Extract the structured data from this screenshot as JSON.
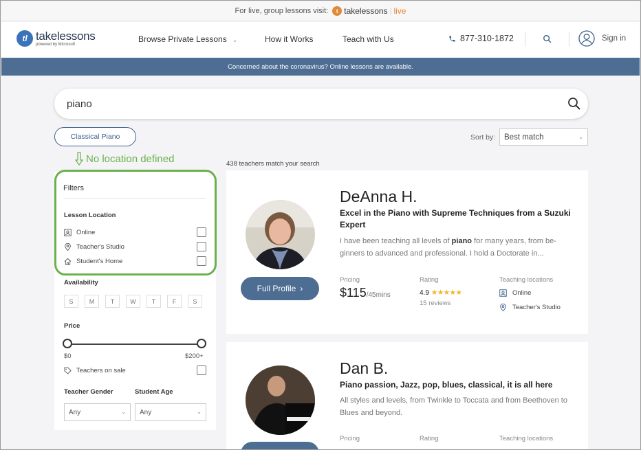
{
  "promo": {
    "text": "For live, group lessons visit:",
    "brand": "takelessons",
    "sep": "|",
    "live": "live"
  },
  "header": {
    "logo_name": "takelessons",
    "logo_sub": "powered by Microsoft",
    "nav": [
      "Browse Private Lessons",
      "How it Works",
      "Teach with Us"
    ],
    "phone": "877-310-1872",
    "sign_in": "Sign in"
  },
  "banner": "Concerned about the coronavirus? Online lessons are available.",
  "search": {
    "value": "piano"
  },
  "tag": "Classical Piano",
  "sort": {
    "label": "Sort by:",
    "value": "Best match"
  },
  "annotation": "No location defined",
  "results_count": "438 teachers match your search",
  "filters": {
    "title": "Filters",
    "lesson_location": {
      "heading": "Lesson Location",
      "options": [
        "Online",
        "Teacher's Studio",
        "Student's Home"
      ]
    },
    "availability": {
      "heading": "Availability",
      "days": [
        "S",
        "M",
        "T",
        "W",
        "T",
        "F",
        "S"
      ]
    },
    "price": {
      "heading": "Price",
      "min": "$0",
      "max": "$200+",
      "sale_label": "Teachers on sale"
    },
    "teacher_gender": {
      "heading": "Teacher Gender",
      "value": "Any"
    },
    "student_age": {
      "heading": "Student Age",
      "value": "Any"
    }
  },
  "teachers": [
    {
      "name": "DeAnna H.",
      "title": "Excel in the Piano with Supreme Techniques from a Suzuki Expert",
      "desc_pre": "I have been teaching all levels of ",
      "desc_bold": "piano",
      "desc_post": " for many years, from be-ginners to advanced and professional. I hold a Doctorate in...",
      "button": "Full Profile",
      "pricing_label": "Pricing",
      "price": "$115",
      "price_unit": "/45mins",
      "rating_label": "Rating",
      "rating": "4.9",
      "stars": 4.9,
      "reviews": "15 reviews",
      "locations_label": "Teaching locations",
      "locations": [
        "Online",
        "Teacher's Studio"
      ]
    },
    {
      "name": "Dan B.",
      "title": "Piano passion, Jazz, pop, blues, classical, it is all here",
      "desc": "All styles and levels, from Twinkle to Toccata and from Beethoven to Blues and beyond.",
      "pricing_label": "Pricing",
      "rating_label": "Rating",
      "locations_label": "Teaching locations"
    }
  ],
  "colors": {
    "accent": "#4e6d93",
    "highlight": "#6ab04c",
    "star": "#f0b429"
  }
}
